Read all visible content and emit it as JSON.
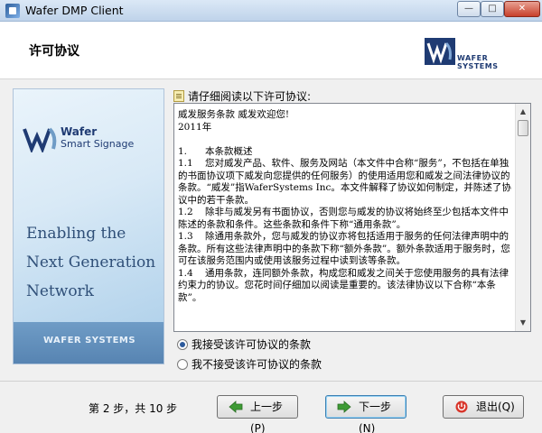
{
  "window": {
    "title": "Wafer DMP Client"
  },
  "header": {
    "page_title": "许可协议",
    "logo_text": "WAFER SYSTEMS"
  },
  "banner": {
    "brand_line1": "Wafer",
    "brand_line2": "Smart Signage",
    "slogan": "Enabling the Next Generation Network",
    "footer": "WAFER SYSTEMS"
  },
  "license": {
    "label": "请仔细阅读以下许可协议:",
    "text": "威发服务条款 威发欢迎您!\n2011年\n\n1.      本条款概述\n1.1    您对威发产品、软件、服务及网站（本文件中合称“服务”，不包括在单独的书面协议项下威发向您提供的任何服务）的使用适用您和威发之间法律协议的条款。“威发”指WaferSystems Inc。本文件解释了协议如何制定，并陈述了协议中的若干条款。\n1.2    除非与威发另有书面协议，否则您与威发的协议将始终至少包括本文件中陈述的条款和条件。这些条款和条件下称“通用条款”。\n1.3    除通用条款外，您与威发的协议亦将包括适用于服务的任何法律声明中的条款。所有这些法律声明中的条款下称“额外条款”。额外条款适用于服务时，您可在该服务范围内或使用该服务过程中读到该等条款。\n1.4    通用条款，连同额外条款，构成您和威发之间关于您使用服务的具有法律约束力的协议。您花时间仔细加以阅读是重要的。该法律协议以下合称“本条款”。"
  },
  "options": {
    "accept": "我接受该许可协议的条款",
    "decline": "我不接受该许可协议的条款",
    "selected": "accept"
  },
  "footer": {
    "steps": "第 2 步，共 10 步",
    "prev_label": "上一步(P)",
    "next_label": "下一步(N)",
    "exit_label": "退出(Q)"
  }
}
